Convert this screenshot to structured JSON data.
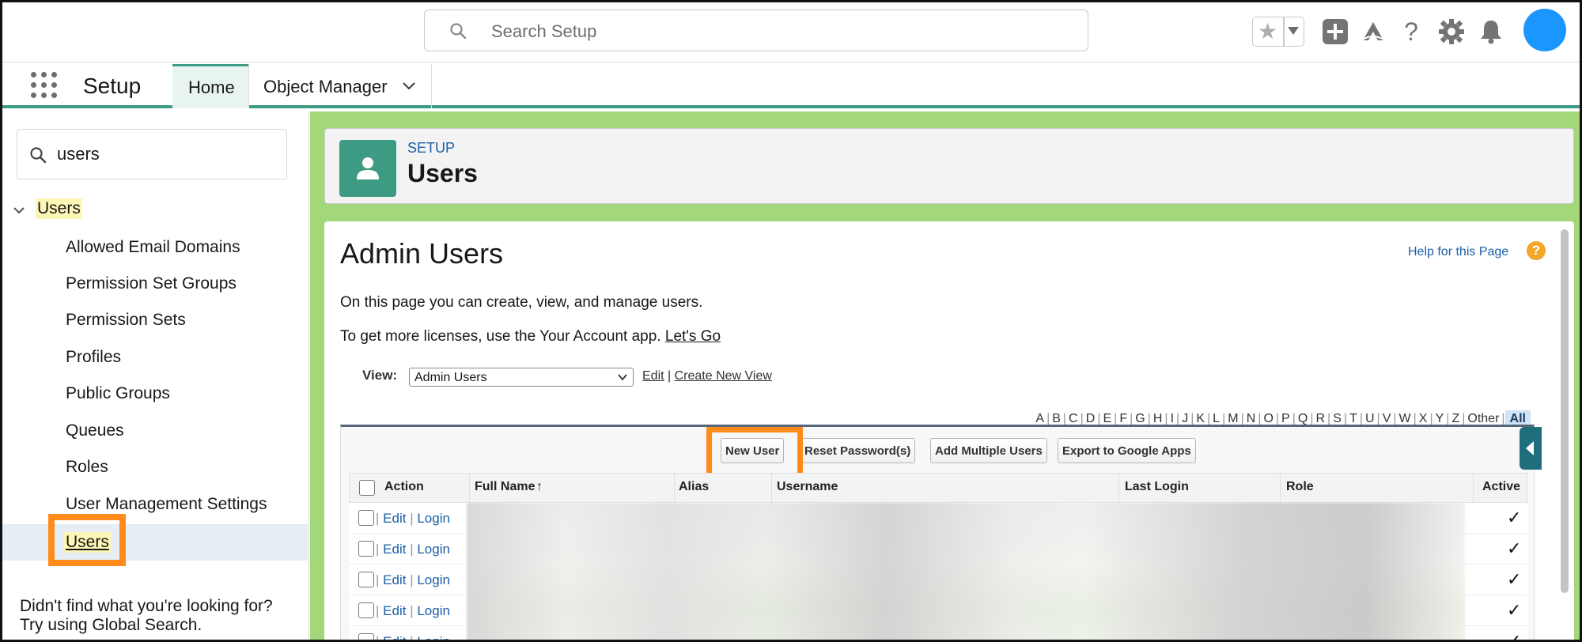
{
  "topbar": {
    "search_placeholder": "Search Setup"
  },
  "nav": {
    "app_name": "Setup",
    "tabs": [
      {
        "label": "Home"
      },
      {
        "label": "Object Manager"
      }
    ]
  },
  "sidebar": {
    "search_value": "users",
    "parent": "Users",
    "items": [
      {
        "label": "Allowed Email Domains"
      },
      {
        "label": "Permission Set Groups"
      },
      {
        "label": "Permission Sets"
      },
      {
        "label": "Profiles"
      },
      {
        "label": "Public Groups"
      },
      {
        "label": "Queues"
      },
      {
        "label": "Roles"
      },
      {
        "label": "User Management Settings"
      },
      {
        "label": "Users"
      }
    ],
    "help_line1": "Didn't find what you're looking for?",
    "help_line2": "Try using Global Search."
  },
  "header": {
    "eyebrow": "SETUP",
    "title": "Users"
  },
  "page": {
    "heading": "Admin Users",
    "help_link": "Help for this Page",
    "help_icon": "?",
    "intro": "On this page you can create, view, and manage users.",
    "licenses_text": "To get more licenses, use the Your Account app.",
    "licenses_link": "Let's Go",
    "view_label": "View:",
    "view_value": "Admin Users",
    "view_edit": "Edit",
    "view_create": "Create New View",
    "alpha": [
      "A",
      "B",
      "C",
      "D",
      "E",
      "F",
      "G",
      "H",
      "I",
      "J",
      "K",
      "L",
      "M",
      "N",
      "O",
      "P",
      "Q",
      "R",
      "S",
      "T",
      "U",
      "V",
      "W",
      "X",
      "Y",
      "Z",
      "Other"
    ],
    "alpha_all": "All"
  },
  "buttons": {
    "new_user": "New User",
    "reset_password": "Reset Password(s)",
    "add_multiple": "Add Multiple Users",
    "export_google": "Export to Google Apps"
  },
  "table": {
    "columns": {
      "action": "Action",
      "full_name": "Full Name",
      "sort_arrow": "↑",
      "alias": "Alias",
      "username": "Username",
      "last_login": "Last Login",
      "role": "Role",
      "active": "Active"
    },
    "row_edit": "Edit",
    "row_login": "Login",
    "row_sep": "|",
    "check": "✓"
  },
  "colors": {
    "accent": "#3e9b86",
    "main_bg": "#a2d879",
    "highlight": "#ff8c1a",
    "link": "#1b5fa8"
  }
}
